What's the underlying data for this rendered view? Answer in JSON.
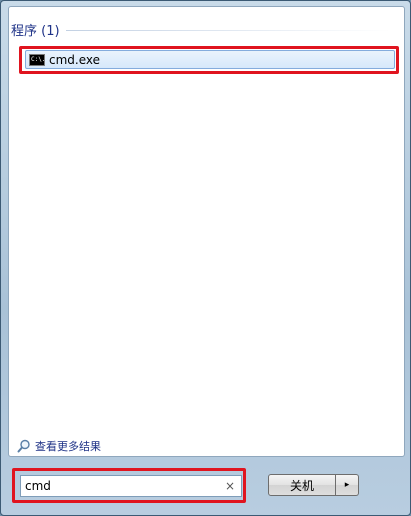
{
  "results": {
    "section_title": "程序 (1)",
    "items": [
      {
        "label": "cmd.exe",
        "icon": "cmd-icon",
        "icon_text": "C:\\."
      }
    ]
  },
  "more_results": {
    "label": "查看更多结果",
    "icon": "magnifier-icon"
  },
  "search": {
    "value": "cmd",
    "clear_glyph": "×"
  },
  "shutdown": {
    "label": "关机",
    "arrow_glyph": "▸"
  },
  "colors": {
    "highlight": "#e0141f",
    "section_text": "#1e3287",
    "selection_border": "#84acdd"
  }
}
